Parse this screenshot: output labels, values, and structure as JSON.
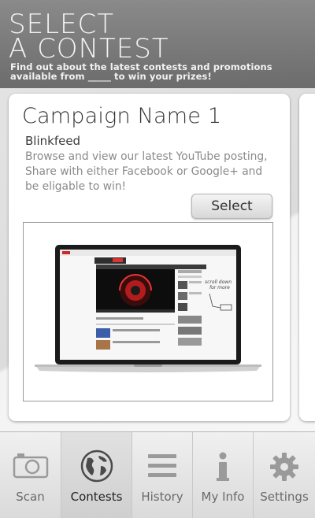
{
  "header": {
    "title_line1": "SELECT",
    "title_line2": "A CONTEST",
    "subtitle": "Find out about the latest contests and promotions available from _____ to win your prizes!"
  },
  "card": {
    "campaign_name": "Campaign Name 1",
    "brand": "Blinkfeed",
    "description": "Browse and view our latest YouTube posting, Share with either Facebook or Google+ and be eligable to win!",
    "select_label": "Select",
    "preview_image": "laptop-youtube-screenshot"
  },
  "tabs": [
    {
      "label": "Scan",
      "icon": "camera-icon",
      "active": false
    },
    {
      "label": "Contests",
      "icon": "globe-icon",
      "active": true
    },
    {
      "label": "History",
      "icon": "list-icon",
      "active": false
    },
    {
      "label": "My Info",
      "icon": "info-icon",
      "active": false
    },
    {
      "label": "Settings",
      "icon": "gear-icon",
      "active": false
    }
  ],
  "colors": {
    "header_bg": "#7a7a7a",
    "card_bg": "#ffffff",
    "tab_active_text": "#222222",
    "tab_text": "#6a6a6a"
  }
}
